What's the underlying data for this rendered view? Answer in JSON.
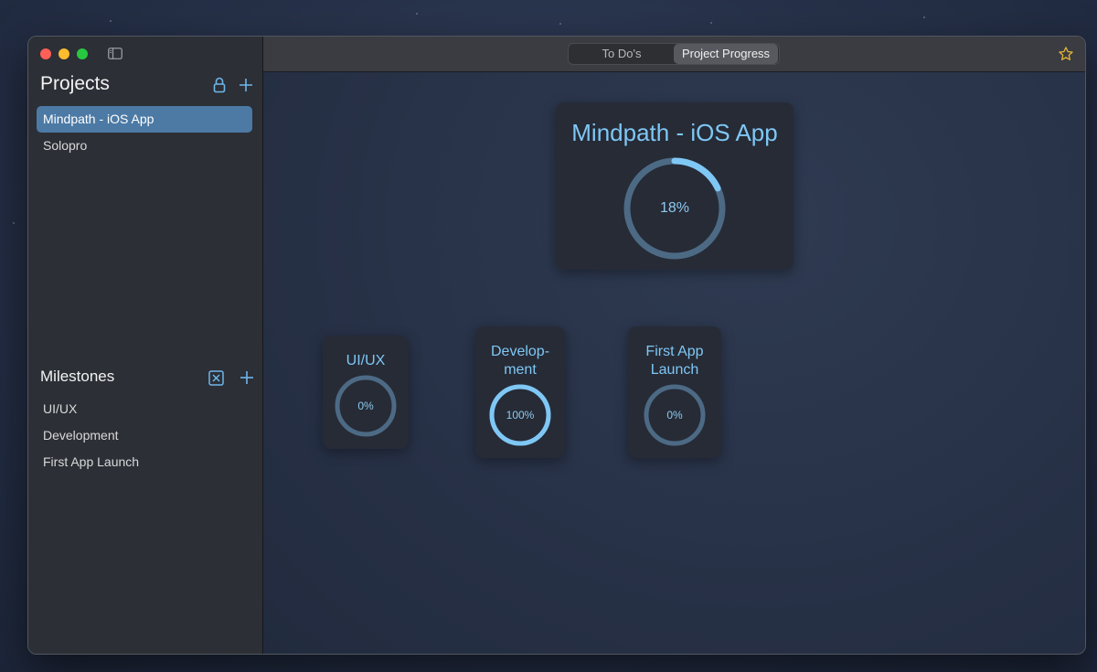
{
  "sidebar": {
    "projects_title": "Projects",
    "projects": [
      {
        "label": "Mindpath - iOS App",
        "selected": true
      },
      {
        "label": "Solopro",
        "selected": false
      }
    ],
    "milestones_title": "Milestones",
    "milestones": [
      {
        "label": "UI/UX"
      },
      {
        "label": "Development"
      },
      {
        "label": "First App Launch"
      }
    ]
  },
  "toolbar": {
    "tabs": [
      {
        "label": "To Do's",
        "active": false
      },
      {
        "label": "Project Progress",
        "active": true
      }
    ]
  },
  "project_card": {
    "title": "Mindpath - iOS App",
    "percent_label": "18%",
    "progress": 0.18
  },
  "milestone_cards": [
    {
      "title": "UI/UX",
      "percent_label": "0%",
      "progress": 0
    },
    {
      "title": "Develop-\nment",
      "percent_label": "100%",
      "progress": 1.0
    },
    {
      "title": "First App\nLaunch",
      "percent_label": "0%",
      "progress": 0
    }
  ],
  "colors": {
    "accent": "#7fc7f5",
    "ring_track": "#4d6a85",
    "selection": "#4c7aa5"
  },
  "icons": {
    "lock": "lock-icon",
    "add": "plus-icon",
    "delete": "x-square-icon",
    "favorite": "star-icon",
    "sidebar": "sidebar-toggle-icon"
  }
}
